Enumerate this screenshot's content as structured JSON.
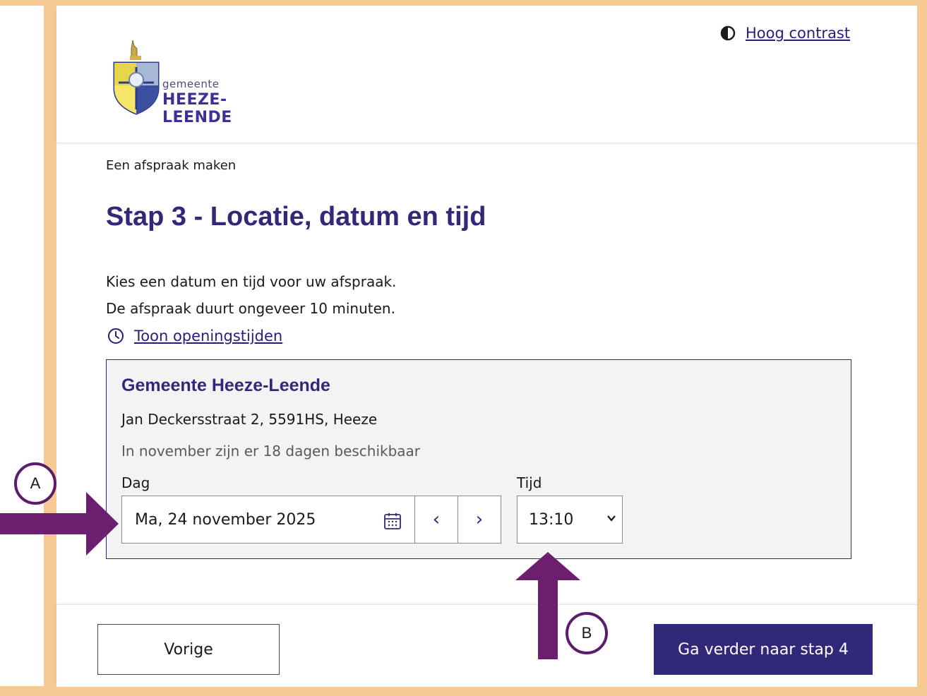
{
  "header": {
    "contrast_label": "Hoog contrast",
    "logo_small": "gemeente",
    "logo_big": "HEEZE-LEENDE"
  },
  "breadcrumb": "Een afspraak maken",
  "title": "Stap 3 - Locatie, datum en tijd",
  "intro": {
    "line1": "Kies een datum en tijd voor uw afspraak.",
    "line2": "De afspraak duurt ongeveer 10 minuten."
  },
  "hours_link": "Toon openingstijden",
  "location": {
    "name": "Gemeente Heeze-Leende",
    "address": "Jan Deckersstraat 2, 5591HS, Heeze",
    "availability": "In november zijn er 18 dagen beschikbaar",
    "day_label": "Dag",
    "day_value": "Ma, 24 november 2025",
    "prev_symbol": "‹",
    "next_symbol": "›",
    "time_label": "Tijd",
    "time_value": "13:10"
  },
  "footer": {
    "prev_label": "Vorige",
    "next_label": "Ga verder naar stap 4"
  },
  "annotations": {
    "a_label": "A",
    "b_label": "B",
    "arrow_color": "#6b1f6e",
    "frame_color": "#f6c992",
    "brand_color": "#32287a"
  }
}
